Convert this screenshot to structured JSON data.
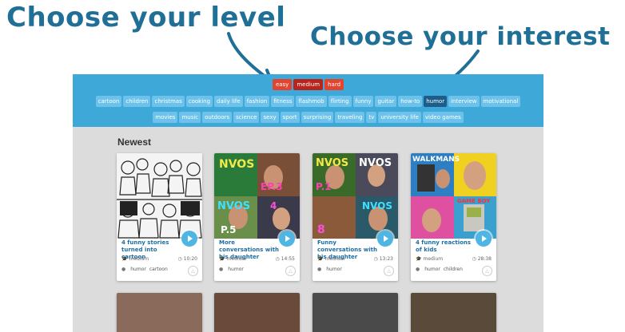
{
  "annotations": {
    "level_callout": "Choose your level",
    "interest_callout": "Choose your interest"
  },
  "levels": [
    "easy",
    "medium",
    "hard"
  ],
  "selected_level": "medium",
  "interest_tags_row1": [
    "cartoon",
    "children",
    "christmas",
    "cooking",
    "daily life",
    "fashion",
    "fitness",
    "flashmob",
    "flirting",
    "funny",
    "guitar",
    "how-to",
    "humor",
    "interview",
    "motivational"
  ],
  "interest_tags_row2": [
    "movies",
    "music",
    "outdoors",
    "science",
    "sexy",
    "sport",
    "surprising",
    "traveling",
    "tv",
    "university life",
    "video games"
  ],
  "selected_interest": "humor",
  "section": {
    "title": "Newest"
  },
  "videos": [
    {
      "title": "4 funny stories turned into cartoon",
      "level": "medium",
      "duration": "10:20",
      "tags": [
        "humor",
        "cartoon"
      ]
    },
    {
      "title": "More conversations with his daughter",
      "level": "medium",
      "duration": "14:55",
      "tags": [
        "humor"
      ]
    },
    {
      "title": "Funny conversations with his daughter",
      "level": "medium",
      "duration": "13:23",
      "tags": [
        "humor"
      ]
    },
    {
      "title": "4 funny reactions of kids",
      "level": "medium",
      "duration": "28:38",
      "tags": [
        "humor",
        "children"
      ]
    }
  ],
  "thumbnail_texts": {
    "convos_word": "NVOS",
    "walkmans": "WALKMANS",
    "gameboy": "GAME BOY"
  },
  "colors": {
    "header": "#3ea9d8",
    "level_button": "#e2442f",
    "tag": "#6cc2ea",
    "tag_active": "#1c5d8a",
    "callout_text": "#1f6f96",
    "page_bg": "#dcdcdc"
  }
}
